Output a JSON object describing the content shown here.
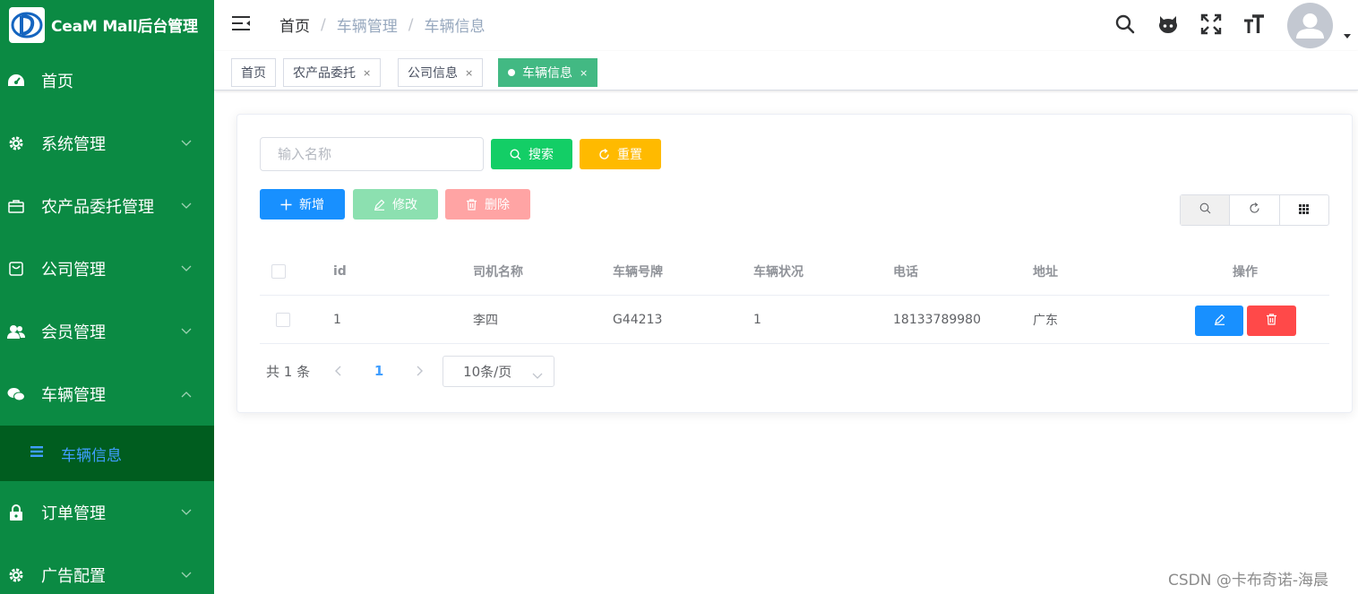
{
  "app": {
    "title": "CeaM Mall后台管理"
  },
  "sidebar": {
    "items": [
      {
        "label": "首页",
        "icon": "dashboard-icon"
      },
      {
        "label": "系统管理",
        "icon": "gear-icon"
      },
      {
        "label": "农产品委托管理",
        "icon": "briefcase-icon"
      },
      {
        "label": "公司管理",
        "icon": "shop-icon"
      },
      {
        "label": "会员管理",
        "icon": "users-icon"
      },
      {
        "label": "车辆管理",
        "icon": "wechat-icon"
      },
      {
        "label": "订单管理",
        "icon": "lock-icon"
      },
      {
        "label": "广告配置",
        "icon": "gear-icon"
      }
    ],
    "submenu": {
      "label": "车辆信息",
      "icon": "list-icon"
    }
  },
  "header": {
    "breadcrumb": [
      "首页",
      "车辆管理",
      "车辆信息"
    ],
    "tools": [
      "search-icon",
      "github-icon",
      "fullscreen-icon",
      "font-size-icon"
    ]
  },
  "tags": [
    {
      "label": "首页",
      "closable": false,
      "active": false
    },
    {
      "label": "农产品委托",
      "closable": true,
      "active": false
    },
    {
      "label": "公司信息",
      "closable": true,
      "active": false
    },
    {
      "label": "车辆信息",
      "closable": true,
      "active": true
    }
  ],
  "search": {
    "placeholder": "输入名称",
    "search_label": "搜索",
    "reset_label": "重置"
  },
  "actions": {
    "add_label": "新增",
    "edit_label": "修改",
    "delete_label": "删除"
  },
  "colors": {
    "sidebar": "#0b8a43",
    "sidebar_active": "#005d1f",
    "primary": "#1890ff",
    "success": "#13ce66",
    "warning": "#ffba00",
    "danger": "#ff4949",
    "tag_active": "#42b983"
  },
  "table": {
    "columns": [
      "id",
      "司机名称",
      "车辆号牌",
      "车辆状况",
      "电话",
      "地址",
      "操作"
    ],
    "rows": [
      {
        "id": "1",
        "driver": "李四",
        "plate": "G44213",
        "status": "1",
        "phone": "18133789980",
        "address": "广东"
      }
    ]
  },
  "pagination": {
    "total_text": "共 1 条",
    "current_page": "1",
    "page_size": "10条/页"
  },
  "watermark": "CSDN @卡布奇诺-海晨"
}
